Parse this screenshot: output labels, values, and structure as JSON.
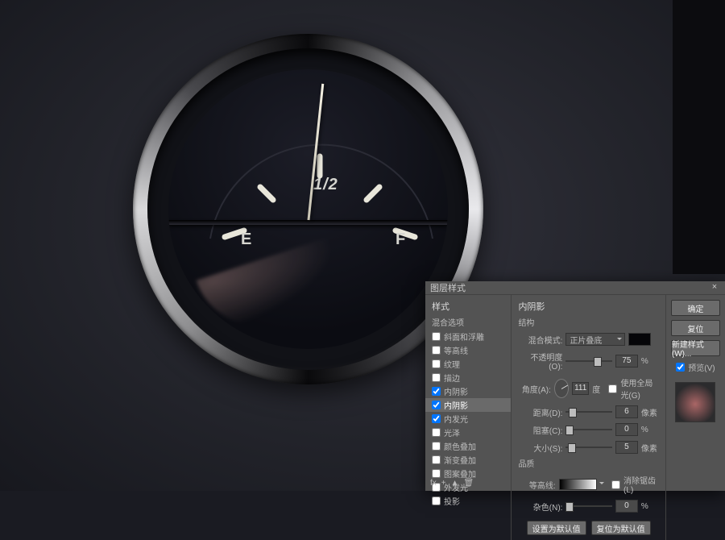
{
  "gauge": {
    "label_e": "E",
    "label_f": "F",
    "label_half": "1/2"
  },
  "dialog": {
    "title": "图层样式",
    "close": "×",
    "styles_header": "样式",
    "blend_opts": "混合选项",
    "list": [
      {
        "label": "斜面和浮雕",
        "checked": false
      },
      {
        "label": "等高线",
        "checked": false
      },
      {
        "label": "纹理",
        "checked": false
      },
      {
        "label": "描边",
        "checked": false
      },
      {
        "label": "内阴影",
        "checked": true,
        "sel": false
      },
      {
        "label": "内阴影",
        "checked": true,
        "sel": true
      },
      {
        "label": "内发光",
        "checked": true
      },
      {
        "label": "光泽",
        "checked": false
      },
      {
        "label": "颜色叠加",
        "checked": false
      },
      {
        "label": "渐变叠加",
        "checked": false
      },
      {
        "label": "图案叠加",
        "checked": false
      },
      {
        "label": "外发光",
        "checked": false
      },
      {
        "label": "投影",
        "checked": false
      }
    ],
    "panel": {
      "title": "内阴影",
      "structure": "结构",
      "blend_mode_label": "混合模式:",
      "blend_mode_value": "正片叠底",
      "opacity_label": "不透明度(O):",
      "opacity_value": "75",
      "opacity_unit": "%",
      "angle_label": "角度(A):",
      "angle_value": "111",
      "angle_unit": "度",
      "global_light": "使用全局光(G)",
      "distance_label": "距离(D):",
      "distance_value": "6",
      "distance_unit": "像素",
      "choke_label": "阻塞(C):",
      "choke_value": "0",
      "choke_unit": "%",
      "size_label": "大小(S):",
      "size_value": "5",
      "size_unit": "像素",
      "quality": "品质",
      "contour_label": "等高线:",
      "antialias": "消除锯齿(L)",
      "noise_label": "杂色(N):",
      "noise_value": "0",
      "noise_unit": "%",
      "make_default": "设置为默认值",
      "reset_default": "复位为默认值"
    },
    "buttons": {
      "ok": "确定",
      "cancel": "复位",
      "new_style": "新建样式(W)...",
      "preview": "预览(V)"
    }
  }
}
